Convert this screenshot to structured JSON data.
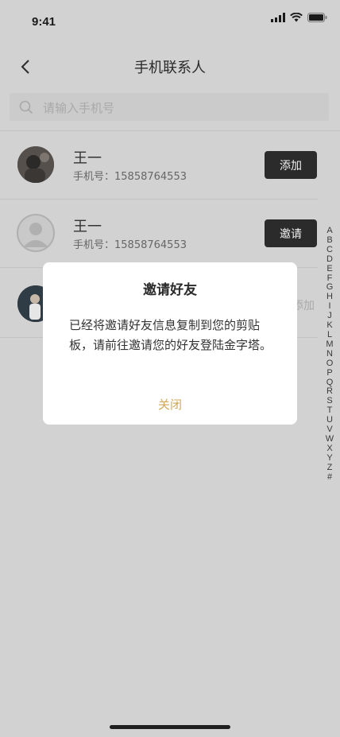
{
  "status_bar": {
    "time": "9:41"
  },
  "nav": {
    "title": "手机联系人"
  },
  "search": {
    "placeholder": "请输入手机号"
  },
  "contacts": [
    {
      "name": "王一",
      "phone_label": "手机号：15858764553",
      "action": "添加"
    },
    {
      "name": "王一",
      "phone_label": "手机号：15858764553",
      "action": "邀请"
    },
    {
      "name": "",
      "phone_label": "",
      "action": "添加"
    }
  ],
  "index_letters": [
    "A",
    "B",
    "C",
    "D",
    "E",
    "F",
    "G",
    "H",
    "I",
    "J",
    "K",
    "L",
    "M",
    "N",
    "O",
    "P",
    "Q",
    "R",
    "S",
    "T",
    "U",
    "V",
    "W",
    "X",
    "Y",
    "Z",
    "#"
  ],
  "modal": {
    "title": "邀请好友",
    "body": "已经将邀请好友信息复制到您的剪贴板，请前往邀请您的好友登陆金字塔。",
    "close": "关闭"
  },
  "colors": {
    "accent": "#d1a857",
    "button_bg": "#2b2b2b",
    "overlay_bg": "#d2d2d2"
  }
}
